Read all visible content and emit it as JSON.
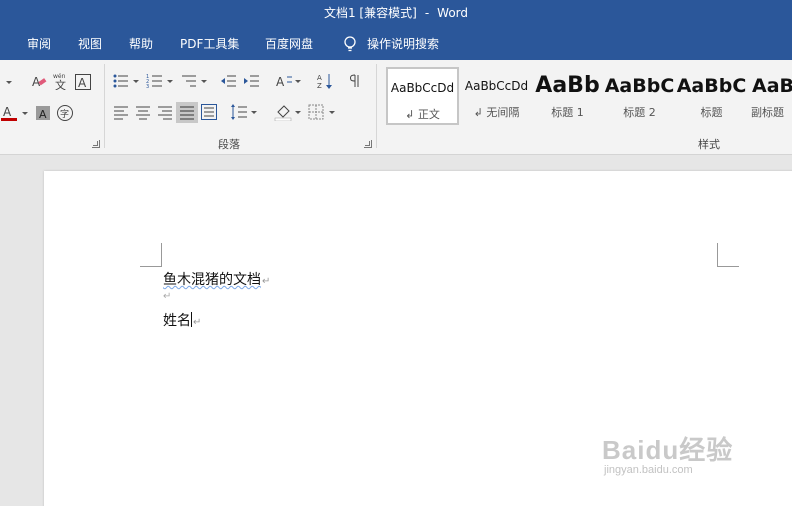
{
  "window": {
    "doc_title": "文档1 [兼容模式]",
    "separator": "-",
    "app_name": "Word"
  },
  "menu": {
    "items": [
      "审阅",
      "视图",
      "帮助",
      "PDF工具集",
      "百度网盘"
    ],
    "tell_me": "操作说明搜索"
  },
  "ribbon": {
    "paragraph_group_label": "段落",
    "styles_group_label": "样式",
    "font_color": "#c00000",
    "styles": [
      {
        "preview": "AaBbCcDd",
        "name": "正文",
        "name_prefix": "↲",
        "selected": true
      },
      {
        "preview": "AaBbCcDd",
        "name": "无间隔",
        "name_prefix": "↲",
        "selected": false
      },
      {
        "preview": "AaBb",
        "name": "标题 1",
        "name_prefix": "",
        "selected": false
      },
      {
        "preview": "AaBbC",
        "name": "标题 2",
        "name_prefix": "",
        "selected": false
      },
      {
        "preview": "AaBbC",
        "name": "标题",
        "name_prefix": "",
        "selected": false
      },
      {
        "preview": "AaBl",
        "name": "副标题",
        "name_prefix": "",
        "selected": false
      }
    ]
  },
  "document": {
    "lines": [
      "鱼木混猪的文档",
      "",
      "姓名"
    ],
    "paragraph_mark": "↵"
  },
  "watermark": {
    "logo": "Baidu经验",
    "url": "jingyan.baidu.com"
  },
  "colors": {
    "titlebar": "#2b579a",
    "ribbon": "#f3f3f3",
    "workspace": "#e6e6e6"
  }
}
